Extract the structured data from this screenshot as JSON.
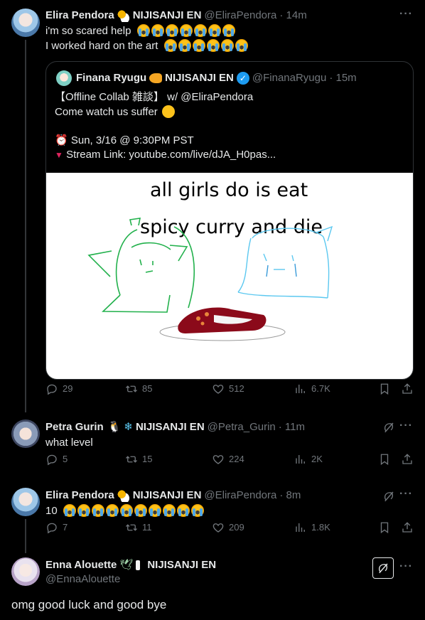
{
  "tweet1": {
    "author": "Elira Pendora",
    "affiliation": "NIJISANJI EN",
    "handle": "@EliraPendora",
    "time": "· 14m",
    "line1": "i'm so scared help",
    "line2": "I worked hard on the art",
    "actions": {
      "replies": "29",
      "retweets": "85",
      "likes": "512",
      "views": "6.7K"
    }
  },
  "quote": {
    "author": "Finana Ryugu",
    "affiliation": "NIJISANJI EN",
    "handle": "@FinanaRyugu",
    "time": "· 15m",
    "line1": "【Offline Collab 雑談】 w/ @EliraPendora",
    "line2": "Come watch us suffer",
    "line3": "Sun, 3/16 @ 9:30PM PST",
    "line4": "Stream Link: youtube.com/live/dJA_H0pas...",
    "image_line1": "all girls do is eat",
    "image_line2": "spicy curry and die"
  },
  "reply1": {
    "author": "Petra Gurin",
    "affiliation": "NIJISANJI EN",
    "handle": "@Petra_Gurin",
    "time": "· 11m",
    "text": "what level",
    "actions": {
      "replies": "5",
      "retweets": "15",
      "likes": "224",
      "views": "2K"
    }
  },
  "reply2": {
    "author": "Elira Pendora",
    "affiliation": "NIJISANJI EN",
    "handle": "@EliraPendora",
    "time": "· 8m",
    "text": "10",
    "actions": {
      "replies": "7",
      "retweets": "11",
      "likes": "209",
      "views": "1.8K"
    }
  },
  "reply3": {
    "author": "Enna Alouette",
    "affiliation": "NIJISANJI EN",
    "handle": "@EnnaAlouette",
    "text": "omg good luck and good bye"
  },
  "icons": [
    "reply-icon",
    "retweet-icon",
    "like-icon",
    "views-icon",
    "bookmark-icon",
    "share-icon",
    "grok-icon",
    "more-icon"
  ],
  "colors": {
    "background": "#000000",
    "text": "#e7e9ea",
    "muted": "#71767b",
    "verified": "#1d9bf0"
  }
}
